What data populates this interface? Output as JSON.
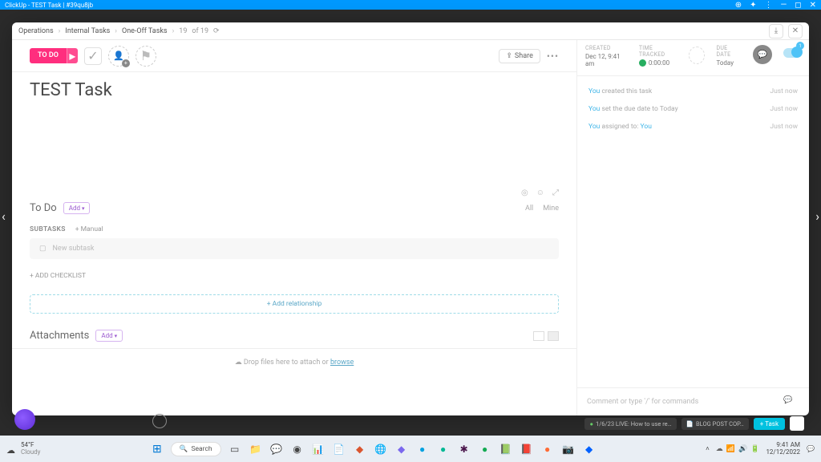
{
  "titlebar": {
    "text": "ClickUp - TEST Task | #39qu8jb"
  },
  "breadcrumbs": {
    "items": [
      "Operations",
      "Internal Tasks",
      "One-Off Tasks"
    ],
    "current": "19",
    "of": "of 19"
  },
  "toolbar": {
    "status": "TO DO",
    "share": "Share"
  },
  "meta": {
    "created_label": "CREATED",
    "created_val": "Dec 12, 9:41 am",
    "time_label": "TIME TRACKED",
    "time_val": "0:00:00",
    "due_label": "DUE DATE",
    "due_val": "Today"
  },
  "feed": {
    "items": [
      {
        "who": "You",
        "text": " created this task",
        "time": "Just now"
      },
      {
        "who": "You",
        "text": " set the due date to Today",
        "time": "Just now"
      },
      {
        "who": "You",
        "text": " assigned to: ",
        "who2": "You",
        "time": "Just now"
      }
    ]
  },
  "comment_placeholder": "Comment or type '/' for commands",
  "task": {
    "title": "TEST Task",
    "todo_label": "To Do",
    "add": "Add",
    "filters_all": "All",
    "filters_mine": "Mine",
    "subtasks_label": "SUBTASKS",
    "manual": "+ Manual",
    "new_subtask": "New subtask",
    "add_checklist": "+ ADD CHECKLIST",
    "add_relationship": "+ Add relationship",
    "attachments": "Attachments",
    "drop_text": "Drop files here to attach or ",
    "browse": "browse"
  },
  "bottombar": {
    "chip1": "1/6/23 LIVE: How to use re…",
    "chip2": "BLOG POST COP…",
    "task_btn": "Task"
  },
  "taskbar": {
    "temp": "54°F",
    "cond": "Cloudy",
    "search": "Search",
    "time": "9:41 AM",
    "date": "12/12/2022"
  }
}
